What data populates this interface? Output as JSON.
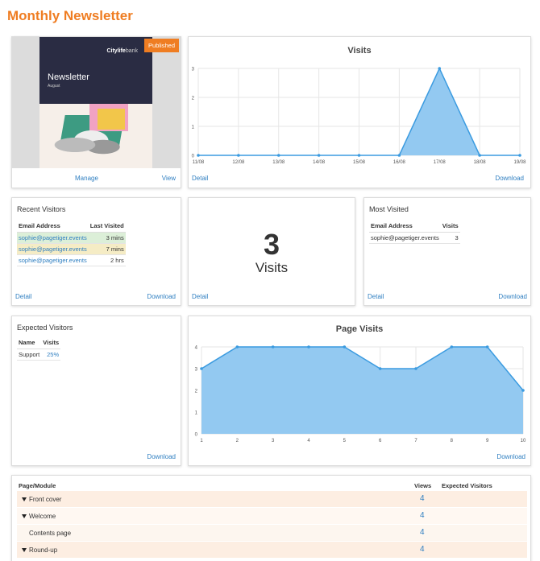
{
  "page": {
    "title": "Monthly Newsletter"
  },
  "preview": {
    "badge": "Published",
    "brand_bold": "Citylife",
    "brand_light": "bank",
    "newsletter_title": "Newsletter",
    "newsletter_subtitle": "August",
    "manage_label": "Manage",
    "view_label": "View"
  },
  "visits_chart": {
    "title": "Visits",
    "detail_label": "Detail",
    "download_label": "Download"
  },
  "recent_visitors": {
    "title": "Recent Visitors",
    "col_email": "Email Address",
    "col_last": "Last Visited",
    "rows": [
      {
        "email": "sophie@pagetiger.events",
        "last": "3 mins"
      },
      {
        "email": "sophie@pagetiger.events",
        "last": "7 mins"
      },
      {
        "email": "sophie@pagetiger.events",
        "last": "2 hrs"
      }
    ],
    "detail_label": "Detail",
    "download_label": "Download"
  },
  "visits_total": {
    "number": "3",
    "label": "Visits",
    "detail_label": "Detail"
  },
  "most_visited": {
    "title": "Most Visited",
    "col_email": "Email Address",
    "col_visits": "Visits",
    "rows": [
      {
        "email": "sophie@pagetiger.events",
        "visits": "3"
      }
    ],
    "detail_label": "Detail",
    "download_label": "Download"
  },
  "expected_visitors": {
    "title": "Expected Visitors",
    "col_name": "Name",
    "col_visits": "Visits",
    "rows": [
      {
        "name": "Support",
        "visits": "25%"
      }
    ],
    "download_label": "Download"
  },
  "page_visits_chart": {
    "title": "Page Visits",
    "download_label": "Download"
  },
  "modules": {
    "col_page": "Page/Module",
    "col_views": "Views",
    "col_expected": "Expected Visitors",
    "rows": [
      {
        "name": "Front cover",
        "views": "4",
        "expandable": true
      },
      {
        "name": "Welcome",
        "views": "4",
        "expandable": true
      },
      {
        "name": "Contents page",
        "views": "4",
        "expandable": false
      },
      {
        "name": "Round-up",
        "views": "4",
        "expandable": true
      }
    ]
  },
  "colors": {
    "accent": "#ef7d22",
    "link": "#2f7fc1",
    "series_line": "#3b9be0",
    "series_fill": "#93c9f1"
  },
  "chart_data": [
    {
      "type": "area",
      "title": "Visits",
      "x": [
        "11/08",
        "12/08",
        "13/08",
        "14/08",
        "15/08",
        "16/08",
        "17/08",
        "18/08",
        "19/08"
      ],
      "series": [
        {
          "values": [
            0,
            0,
            0,
            0,
            0,
            0,
            3,
            0,
            0
          ]
        }
      ],
      "ylim": [
        0,
        3
      ],
      "yticks": [
        0,
        1,
        2,
        3
      ],
      "grid": true
    },
    {
      "type": "area",
      "title": "Page Visits",
      "x": [
        "1",
        "2",
        "3",
        "4",
        "5",
        "6",
        "7",
        "8",
        "9",
        "10"
      ],
      "series": [
        {
          "values": [
            3,
            4,
            4,
            4,
            4,
            3,
            3,
            4,
            4,
            2
          ]
        }
      ],
      "ylim": [
        0,
        4
      ],
      "yticks": [
        0,
        1,
        2,
        3,
        4
      ],
      "grid": true
    }
  ]
}
